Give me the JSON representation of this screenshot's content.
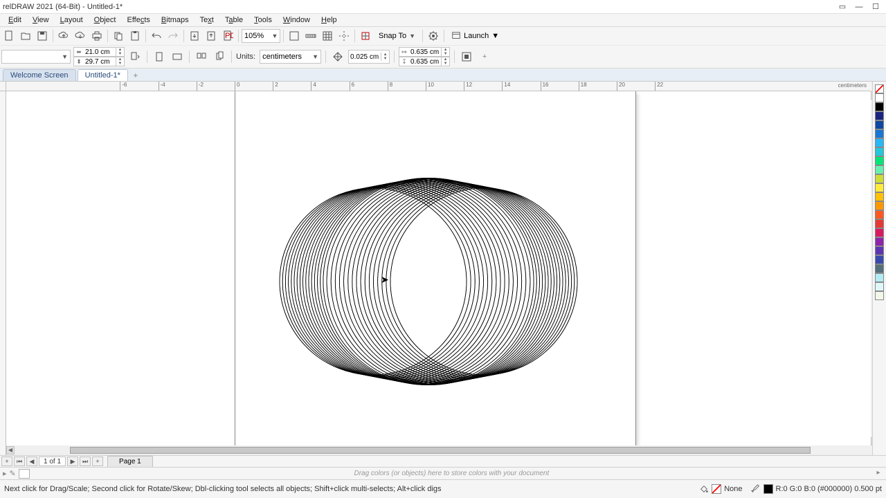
{
  "app": {
    "title": "relDRAW 2021 (64-Bit) - Untitled-1*"
  },
  "menu": [
    "Edit",
    "View",
    "Layout",
    "Object",
    "Effects",
    "Bitmaps",
    "Text",
    "Table",
    "Tools",
    "Window",
    "Help"
  ],
  "toolbar1": {
    "zoom": "105%",
    "snap": "Snap To",
    "launch": "Launch"
  },
  "propbar": {
    "page_w": "21.0 cm",
    "page_h": "29.7 cm",
    "units_label": "Units:",
    "units_value": "centimeters",
    "nudge": "0.025 cm",
    "dup_x": "0.635 cm",
    "dup_y": "0.635 cm"
  },
  "tabs": {
    "welcome": "Welcome Screen",
    "doc": "Untitled-1*"
  },
  "ruler": {
    "unit": "centimeters",
    "ticks": [
      -6,
      -4,
      -2,
      0,
      2,
      4,
      6,
      8,
      10,
      12,
      14,
      16,
      18,
      20,
      22
    ]
  },
  "palette_colors": [
    "#ffffff",
    "#000000",
    "#1a237e",
    "#0d47a1",
    "#1976d2",
    "#29b6f6",
    "#26c6da",
    "#00e676",
    "#69f0ae",
    "#cddc39",
    "#ffeb3b",
    "#ffc107",
    "#ff9800",
    "#ff5722",
    "#e53935",
    "#d81b60",
    "#8e24aa",
    "#5e35b1",
    "#3949ab",
    "#546e7a",
    "#b2ebf2",
    "#e0f7fa",
    "#f1f8e9"
  ],
  "pagenav": {
    "info": "1 of 1",
    "tab": "Page 1"
  },
  "colortray": {
    "hint": "Drag colors (or objects) here to store colors with your document"
  },
  "status": {
    "hint": "Next click for Drag/Scale; Second click for Rotate/Skew; Dbl-clicking tool selects all objects; Shift+click multi-selects; Alt+click digs",
    "fill_label": "None",
    "outline_info": "R:0 G:0 B:0 (#000000) 0.500 pt"
  }
}
